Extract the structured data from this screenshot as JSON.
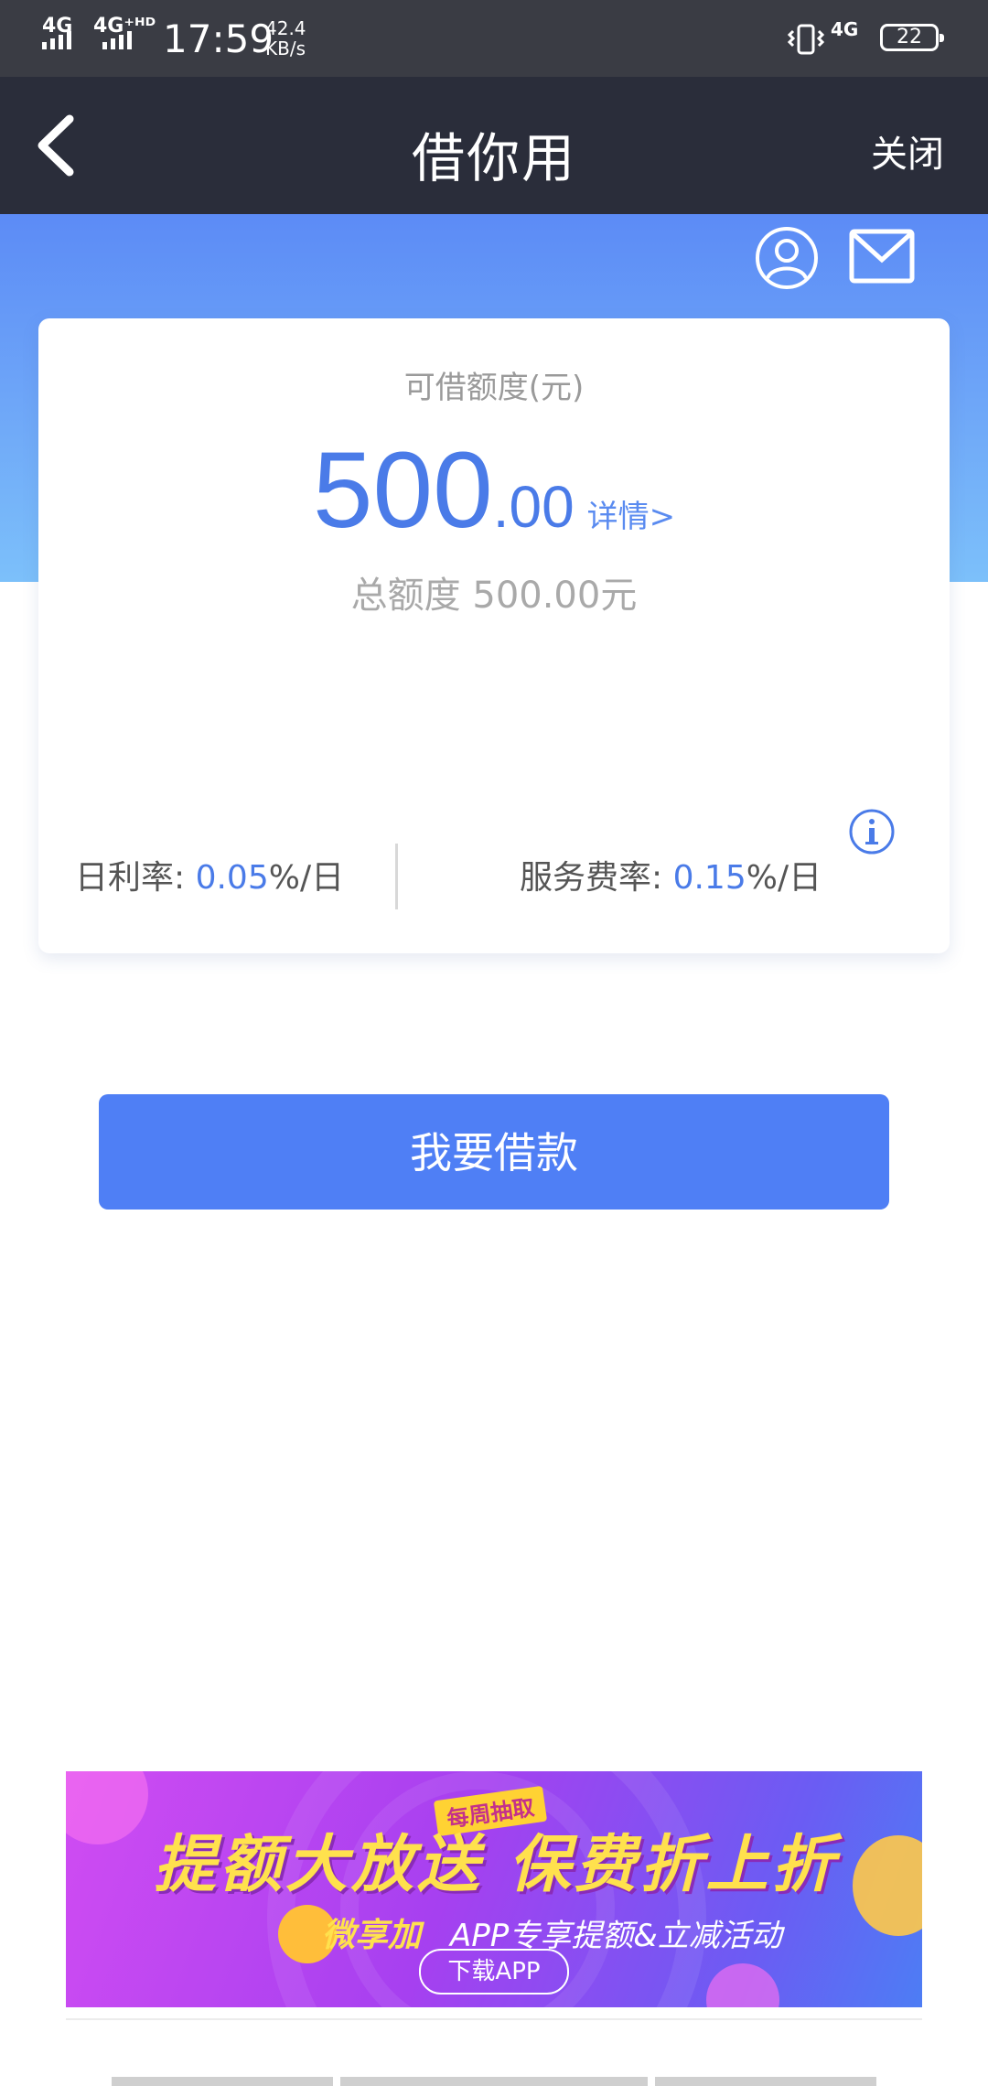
{
  "status_bar": {
    "signal_1": "4G",
    "signal_2": "4G⁺ᴴᴰ",
    "time": "17:59",
    "speed_value": "42.4",
    "speed_unit": "KB/s",
    "network_2": "4G",
    "battery": "22"
  },
  "nav": {
    "back_icon": "chevron-left-icon",
    "title": "借你用",
    "close": "关闭"
  },
  "header_icons": [
    "user-icon",
    "mail-icon"
  ],
  "card": {
    "quota_label": "可借额度(元)",
    "amount_int": "500",
    "amount_dec": ".00",
    "detail_link": "详情>",
    "total_line": "总额度 500.00元",
    "daily_rate_label": "日利率: ",
    "daily_rate_value": "0.05",
    "daily_rate_unit": "%/日",
    "service_rate_label": "服务费率: ",
    "service_rate_value": "0.15",
    "service_rate_unit": "%/日",
    "info_icon": "info-icon"
  },
  "borrow_button": "我要借款",
  "banner": {
    "tag": "每周抽取",
    "title": "提额大放送  保费折上折",
    "subtitle_a": "微享加",
    "subtitle_b": "APP专享提额&立减活动",
    "cta": "下载APP"
  },
  "colors": {
    "primary": "#4f7ff5",
    "navbar": "#2a2d3a",
    "statusbar": "#3a3c44",
    "accent_text": "#4a7be8"
  }
}
